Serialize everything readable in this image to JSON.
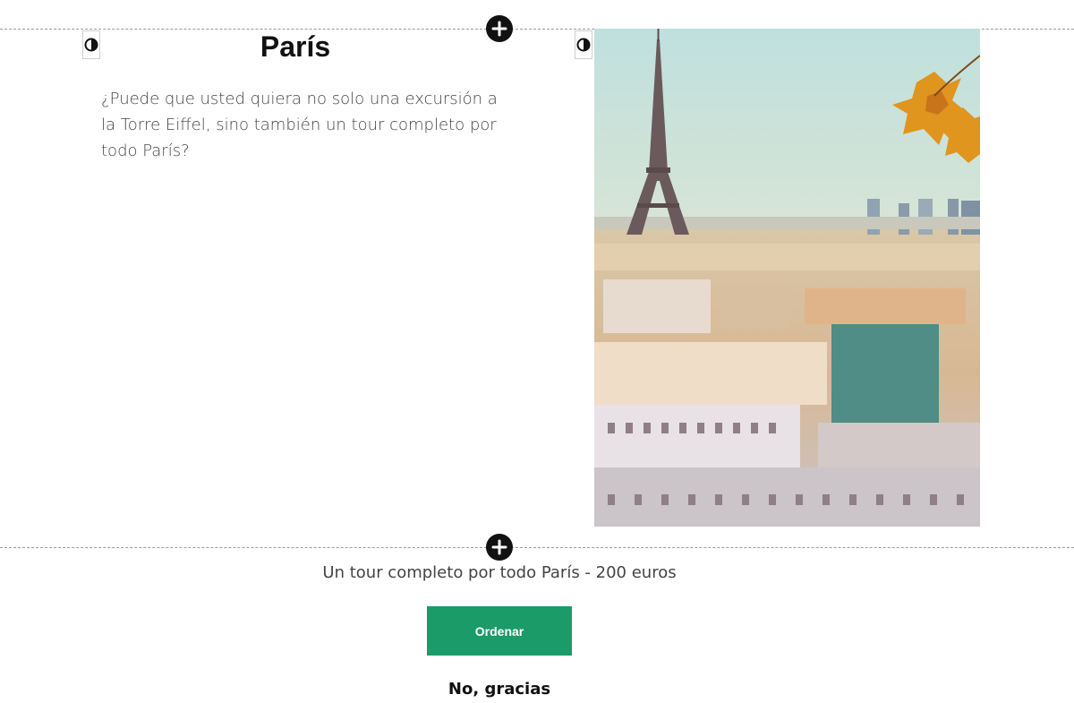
{
  "section": {
    "title": "París",
    "description": "¿Puede que usted quiera no solo una excursión a la Torre Eiffel, sino también un tour completo por todo París?"
  },
  "offer": {
    "price_text": "Un tour completo por todo París - 200 euros",
    "order_label": "Ordenar",
    "decline_label": "No, gracias"
  },
  "colors": {
    "accent": "#1a9b68",
    "control_dark": "#111111"
  },
  "icons": {
    "add": "plus-icon",
    "contrast": "contrast-icon"
  }
}
